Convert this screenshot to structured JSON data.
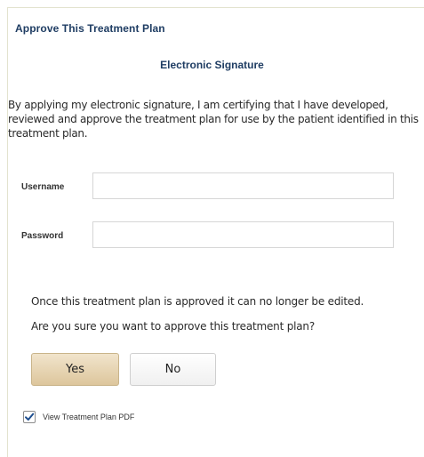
{
  "dialog": {
    "title": "Approve This Treatment Plan",
    "section_title": "Electronic Signature",
    "certification_text": "By applying my electronic signature, I am certifying that I have developed, reviewed and approve the treatment plan for use by the patient identified in this treatment plan."
  },
  "form": {
    "username_label": "Username",
    "username_value": "",
    "password_label": "Password",
    "password_value": ""
  },
  "confirmation": {
    "notice": "Once this treatment plan is approved it can no longer be edited.",
    "question": "Are you sure you want to approve this treatment plan?",
    "yes_label": "Yes",
    "no_label": "No"
  },
  "options": {
    "view_pdf_label": "View Treatment Plan PDF",
    "view_pdf_checked": true,
    "check_icon": "checkmark-icon"
  },
  "colors": {
    "heading": "#1f3d63",
    "checkmark": "#1d4e8f",
    "yes_button": "#e8d7b7"
  }
}
